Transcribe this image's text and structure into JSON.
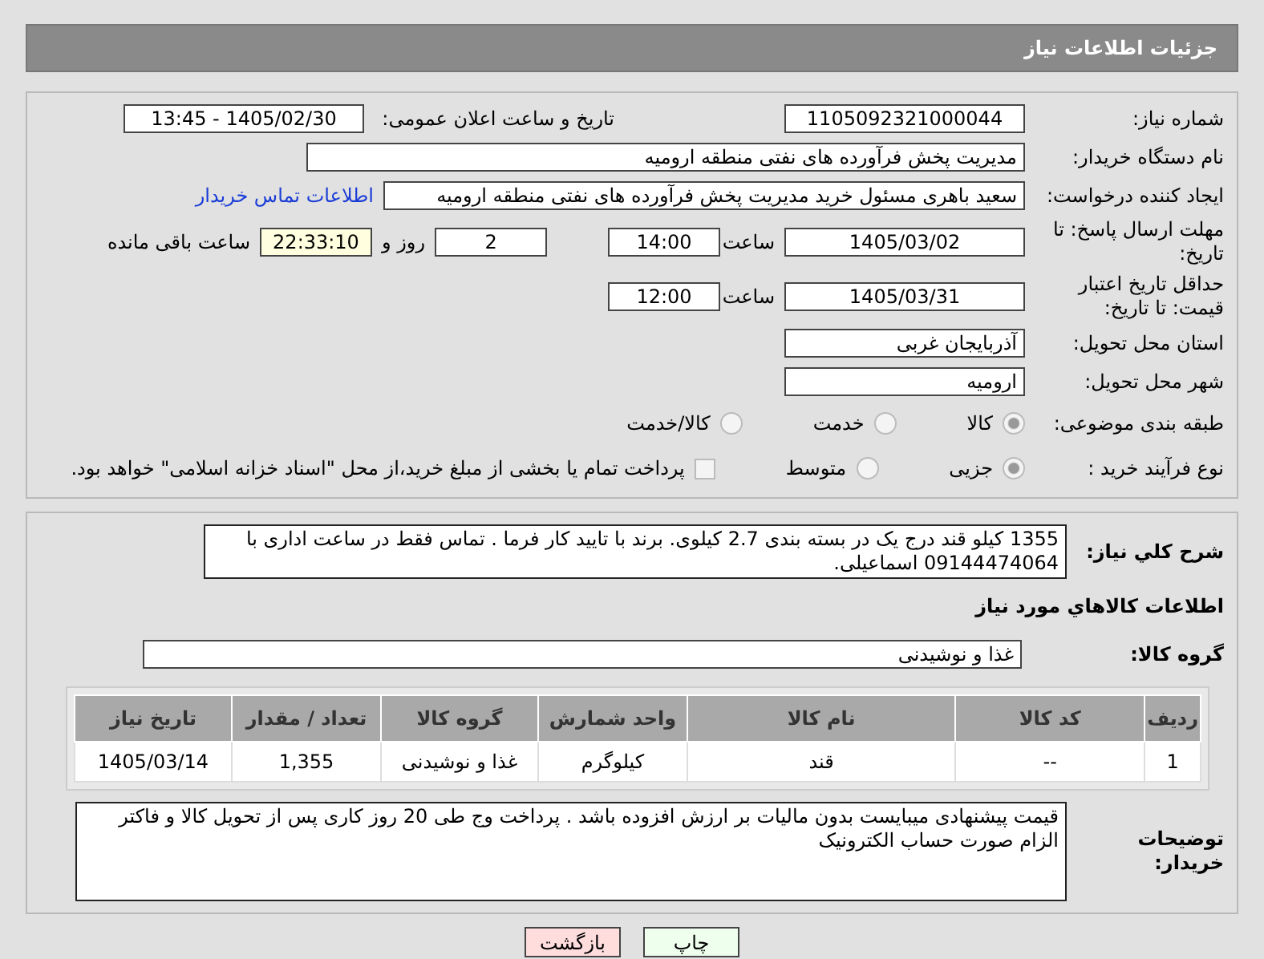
{
  "header": {
    "title": "جزئیات اطلاعات نیاز"
  },
  "need_number": {
    "label": "شماره نیاز:",
    "value": "1105092321000044"
  },
  "announce": {
    "label": "تاریخ و ساعت اعلان عمومی:",
    "value": "1405/02/30 - 13:45"
  },
  "buyer_org": {
    "label": "نام دستگاه خریدار:",
    "value": "مدیریت پخش فرآورده های نفتی منطقه ارومیه"
  },
  "creator": {
    "label": "ایجاد کننده درخواست:",
    "value": "سعید باهری مسئول خرید مدیریت پخش فرآورده های نفتی منطقه ارومیه",
    "link": "اطلاعات تماس خریدار"
  },
  "deadline": {
    "label": "مهلت ارسال پاسخ: تا تاریخ:",
    "date": "1405/03/02",
    "time_label": "ساعت",
    "time": "14:00",
    "days": "2",
    "days_label": "روز و",
    "remaining": "22:33:10",
    "remaining_label": "ساعت باقی مانده"
  },
  "validity": {
    "label": "حداقل تاریخ اعتبار قیمت: تا تاریخ:",
    "date": "1405/03/31",
    "time_label": "ساعت",
    "time": "12:00"
  },
  "province": {
    "label": "استان محل تحویل:",
    "value": "آذربایجان غربی"
  },
  "city": {
    "label": "شهر محل تحویل:",
    "value": "ارومیه"
  },
  "category": {
    "label": "طبقه بندی موضوعی:",
    "options": [
      {
        "label": "کالا",
        "selected": true
      },
      {
        "label": "خدمت",
        "selected": false
      },
      {
        "label": "کالا/خدمت",
        "selected": false
      }
    ]
  },
  "process": {
    "label": "نوع فرآیند خرید :",
    "options": [
      {
        "label": "جزیی",
        "selected": true
      },
      {
        "label": "متوسط",
        "selected": false
      }
    ],
    "payment": {
      "label": "پرداخت تمام یا بخشی از مبلغ خرید،از محل \"اسناد خزانه اسلامی\" خواهد بود.",
      "checked": false
    }
  },
  "description": {
    "label": "شرح کلي نياز:",
    "value": "1355 کیلو قند درج یک در بسته بندی 2.7 کیلوی. برند با تایید کار فرما . تماس فقط در ساعت اداری با 09144474064 اسماعیلی."
  },
  "goods_title": "اطلاعات کالاهاي مورد نياز",
  "goods_group": {
    "label": "گروه کالا:",
    "value": "غذا و نوشیدنی"
  },
  "table": {
    "columns": [
      "ردیف",
      "کد کالا",
      "نام کالا",
      "واحد شمارش",
      "گروه کالا",
      "تعداد / مقدار",
      "تاریخ نیاز"
    ],
    "rows": [
      [
        "1",
        "--",
        "قند",
        "کیلوگرم",
        "غذا و نوشیدنی",
        "1,355",
        "1405/03/14"
      ]
    ]
  },
  "buyer_notes": {
    "label": "توضیحات خریدار:",
    "value": "قیمت پیشنهادی میبایست بدون مالیات بر ارزش افزوده باشد . پرداخت وج طی 20 روز کاری پس از تحویل کالا و فاکتر الزام صورت حساب الکترونیک"
  },
  "buttons": [
    {
      "label": "چاپ",
      "kind": "print"
    },
    {
      "label": "بازگشت",
      "kind": "back"
    }
  ]
}
